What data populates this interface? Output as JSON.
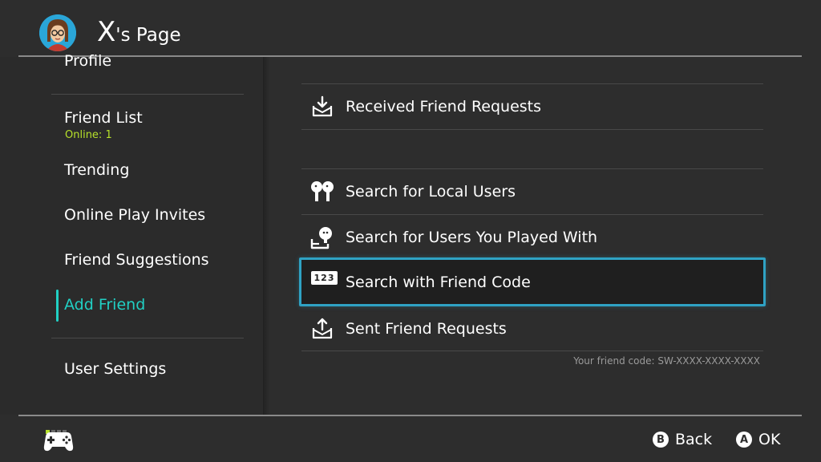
{
  "header": {
    "title_initial": "X",
    "title_suffix": "'s Page"
  },
  "sidebar": {
    "items": [
      {
        "label": "Profile"
      },
      {
        "label": "Friend List",
        "sub": "Online: 1"
      },
      {
        "label": "Trending"
      },
      {
        "label": "Online Play Invites"
      },
      {
        "label": "Friend Suggestions"
      },
      {
        "label": "Add Friend",
        "active": true
      },
      {
        "label": "User Settings"
      }
    ]
  },
  "main": {
    "items": [
      {
        "label": "Received Friend Requests",
        "icon": "inbox-download-icon"
      },
      {
        "label": "Search for Local Users",
        "icon": "local-users-icon"
      },
      {
        "label": "Search for Users You Played With",
        "icon": "played-with-icon"
      },
      {
        "label": "Search with Friend Code",
        "icon": "friend-code-icon",
        "selected": true
      },
      {
        "label": "Sent Friend Requests",
        "icon": "outbox-upload-icon"
      }
    ],
    "friend_code_badge": "123",
    "friend_code_text": "Your friend code: SW-XXXX-XXXX-XXXX"
  },
  "footer": {
    "back_button": "B",
    "back_label": "Back",
    "ok_button": "A",
    "ok_label": "OK"
  },
  "colors": {
    "accent": "#21d0c4",
    "selection_border": "#2fa2c4",
    "online_green": "#b7e22b",
    "background": "#2d2d2d"
  }
}
